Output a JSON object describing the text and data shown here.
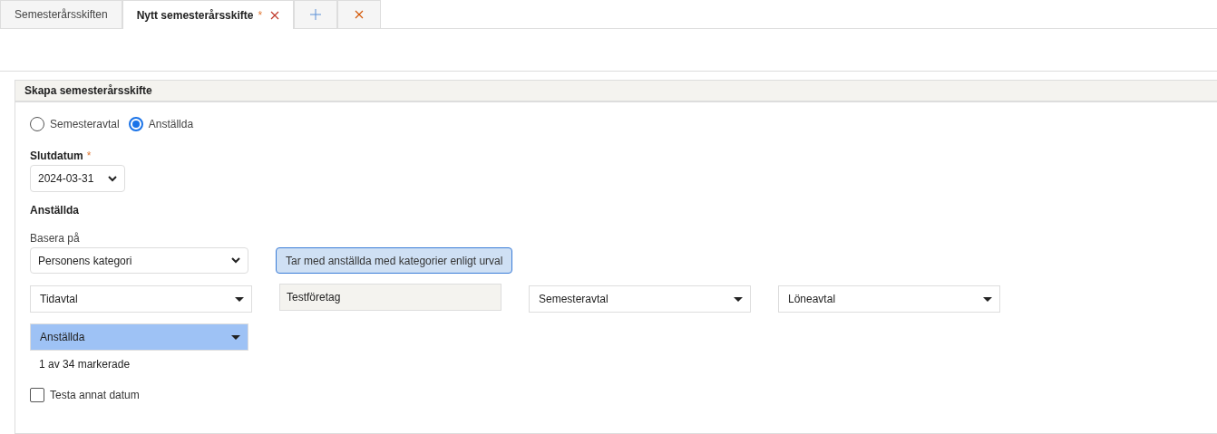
{
  "tabs": [
    {
      "label": "Semesterårsskiften",
      "selected": false,
      "modified": false,
      "closable": false
    },
    {
      "label": "Nytt semesterårsskifte",
      "selected": true,
      "modified": true,
      "closable": true,
      "modified_mark": "*"
    }
  ],
  "panel": {
    "title": "Skapa semesterårsskifte",
    "radios": [
      {
        "label": "Semesteravtal",
        "selected": false
      },
      {
        "label": "Anställda",
        "selected": true
      }
    ],
    "end_date": {
      "label": "Slutdatum",
      "required_mark": "*",
      "value": "2024-03-31"
    },
    "section_heading": "Anställda",
    "base_on": {
      "label": "Basera på",
      "value": "Personens kategori"
    },
    "info_button": "Tar med anställda med kategorier enligt urval",
    "filters": [
      {
        "kind": "dropdown",
        "value": "Tidavtal"
      },
      {
        "kind": "readonly",
        "value": "Testföretag"
      },
      {
        "kind": "dropdown",
        "value": "Semesteravtal"
      },
      {
        "kind": "dropdown",
        "value": "Löneavtal"
      }
    ],
    "employees": {
      "value": "Anställda",
      "highlighted": true
    },
    "selection_count": "1 av 34 markerade",
    "test_other_date": {
      "label": "Testa annat datum",
      "checked": false
    }
  }
}
